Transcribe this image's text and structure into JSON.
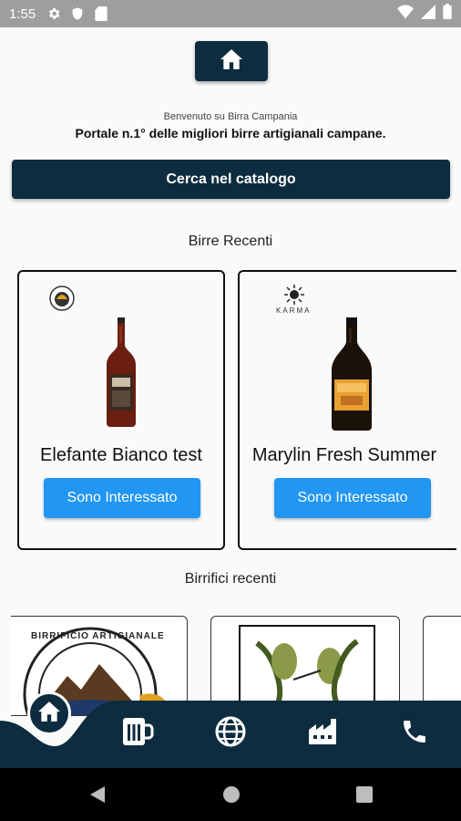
{
  "status_bar": {
    "time": "1:55"
  },
  "header": {
    "welcome": "Benvenuto su Birra Campania",
    "tagline": "Portale n.1° delle migliori birre artigianali campane."
  },
  "search": {
    "label": "Cerca nel catalogo"
  },
  "recent_beers": {
    "title": "Birre Recenti",
    "items": [
      {
        "name": "Elefante Bianco test",
        "button": "Sono Interessato"
      },
      {
        "name": "Marylin Fresh Summer",
        "button": "Sono Interessato",
        "brand": "KARMA"
      }
    ]
  },
  "recent_breweries": {
    "title": "Birrifici recenti",
    "items": [
      {
        "logo_text": "BIRRIFICIO ARTIGIANALE"
      },
      {
        "logo": "two-hops-logo"
      },
      {
        "logo": "partial-card"
      }
    ]
  },
  "bottom_nav": {
    "items": [
      "home-icon",
      "beer-mug-icon",
      "globe-icon",
      "factory-icon",
      "phone-icon"
    ]
  },
  "colors": {
    "primary": "#0d2c3f",
    "accent": "#2196f3",
    "status_bar": "#9e9e9e"
  }
}
